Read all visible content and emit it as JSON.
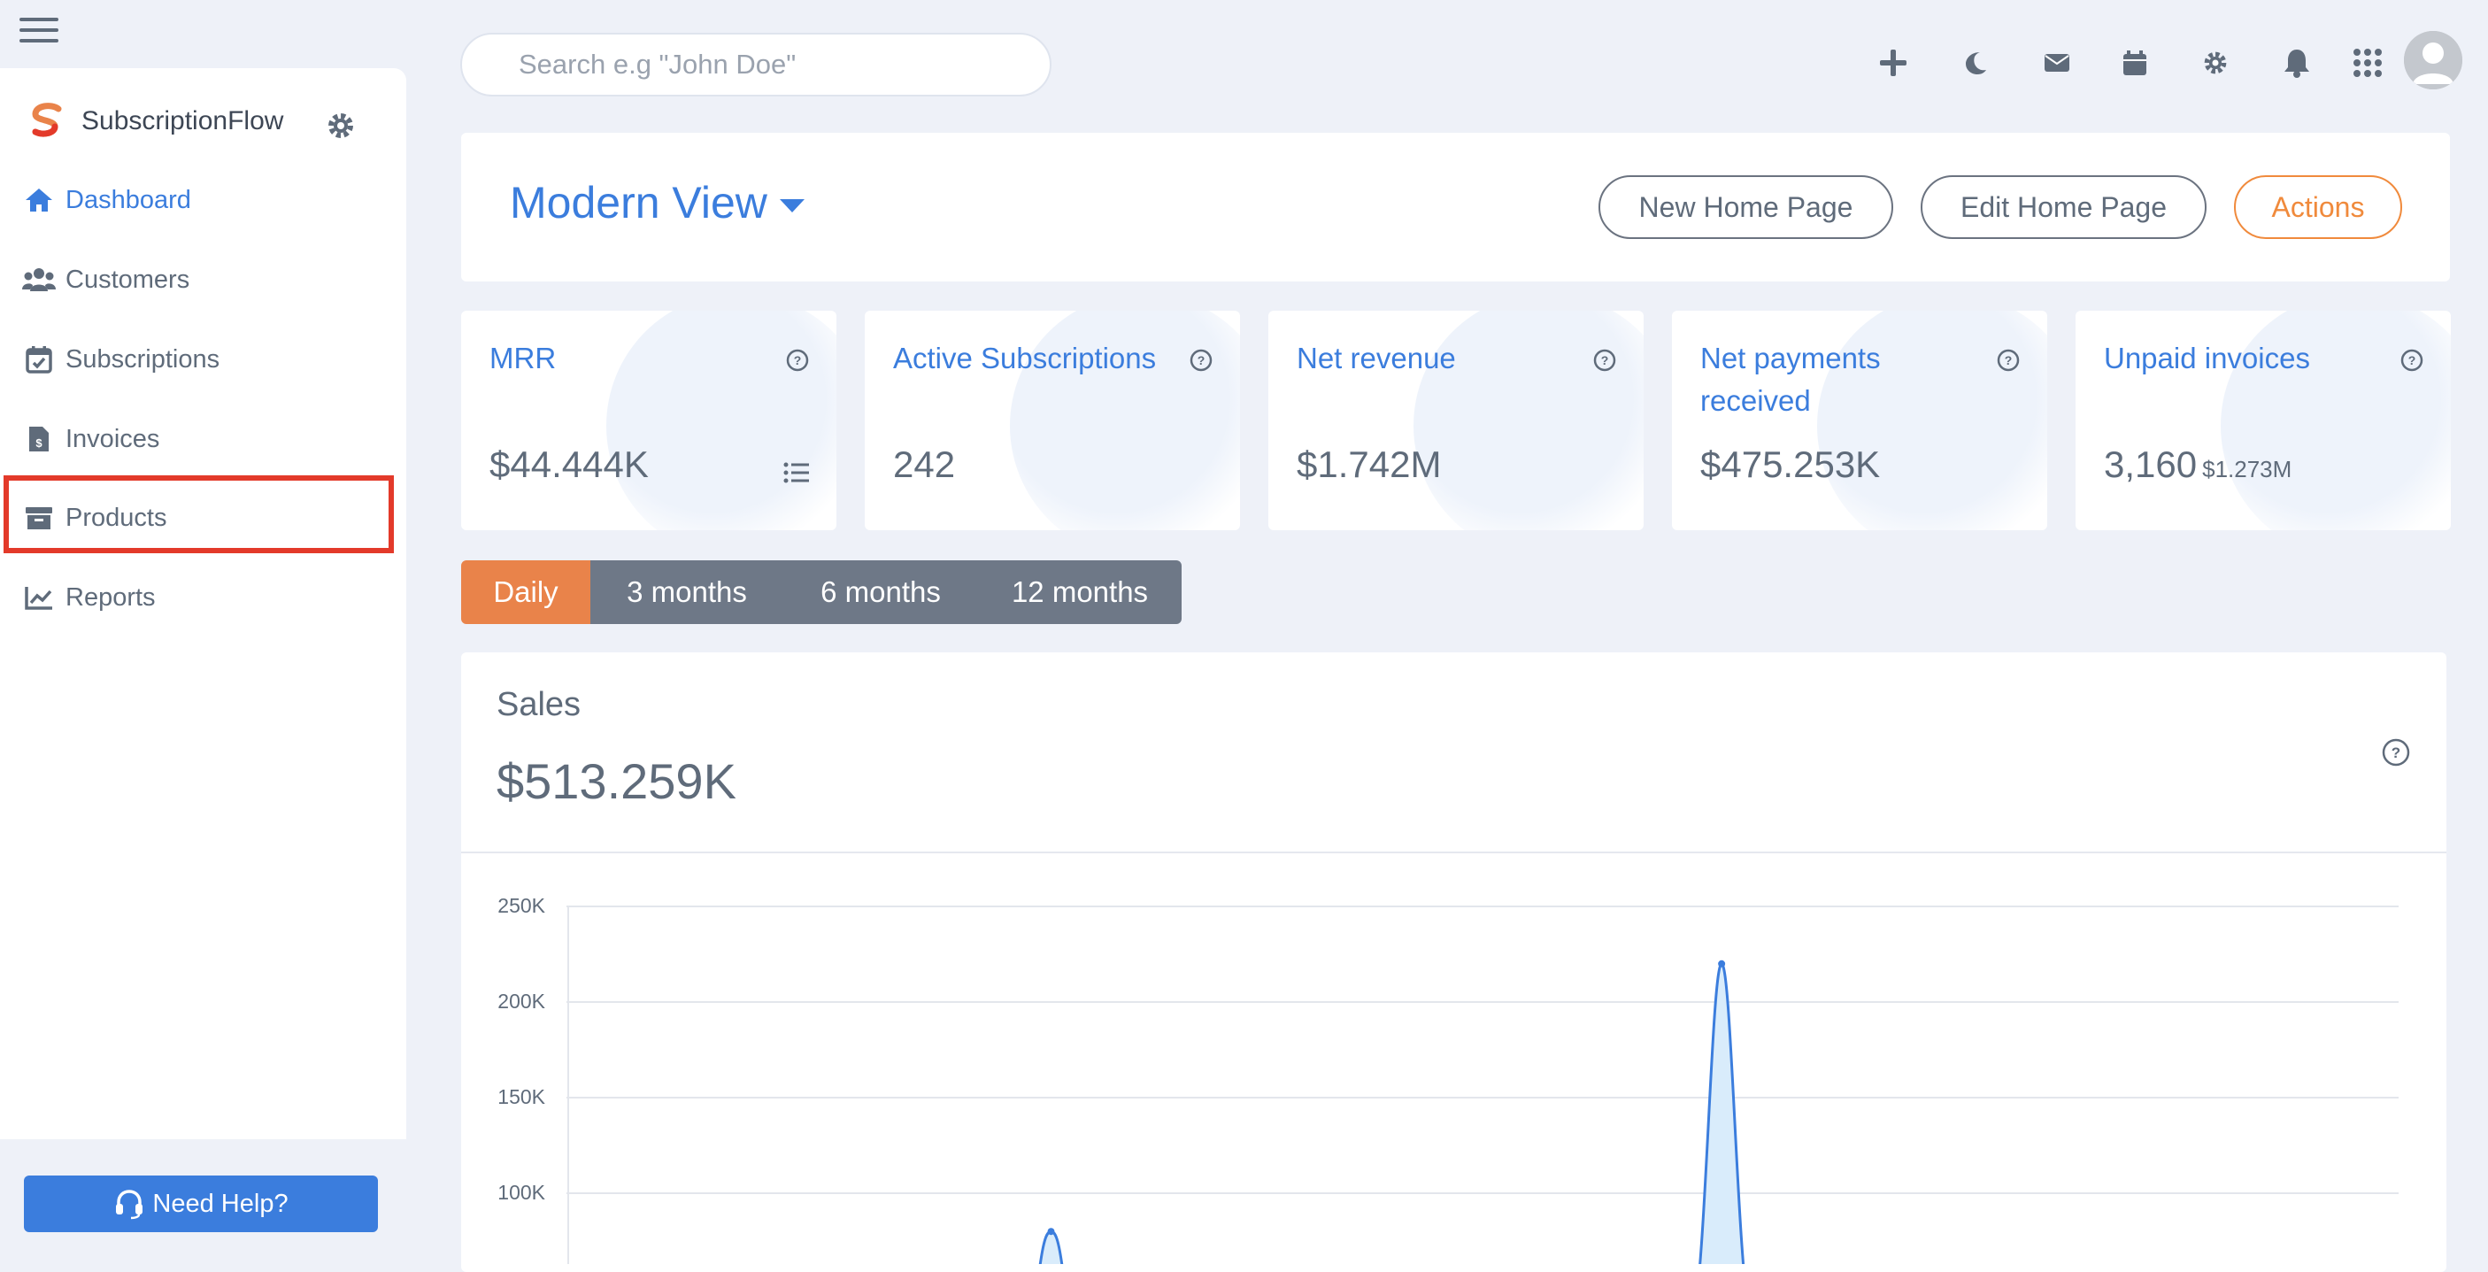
{
  "topbar": {
    "search_placeholder": "Search e.g \"John Doe\"",
    "icons": [
      "plus-icon",
      "moon-icon",
      "envelope-icon",
      "calendar-icon",
      "gear-icon",
      "bell-icon",
      "apps-grid-icon"
    ]
  },
  "sidebar": {
    "brand": "SubscriptionFlow",
    "items": [
      {
        "label": "Dashboard",
        "icon": "home-icon",
        "active": true
      },
      {
        "label": "Customers",
        "icon": "users-icon"
      },
      {
        "label": "Subscriptions",
        "icon": "calendar-check-icon"
      },
      {
        "label": "Invoices",
        "icon": "file-invoice-icon"
      },
      {
        "label": "Products",
        "icon": "archive-box-icon"
      },
      {
        "label": "Reports",
        "icon": "chart-line-icon"
      }
    ],
    "help_label": "Need Help?"
  },
  "header": {
    "view_title": "Modern View",
    "buttons": {
      "new": "New Home Page",
      "edit": "Edit Home Page",
      "actions": "Actions"
    }
  },
  "kpis": [
    {
      "title": "MRR",
      "value": "$44.444K"
    },
    {
      "title": "Active Subscriptions",
      "value": "242"
    },
    {
      "title": "Net revenue",
      "value": "$1.742M"
    },
    {
      "title": "Net payments received",
      "value": "$475.253K"
    },
    {
      "title": "Unpaid invoices",
      "value": "3,160",
      "sub": "$1.273M"
    }
  ],
  "periods": [
    "Daily",
    "3 months",
    "6 months",
    "12 months"
  ],
  "active_period": "Daily",
  "sales": {
    "label": "Sales",
    "value": "$513.259K"
  },
  "chart_data": {
    "type": "area",
    "ylabels": [
      "250K",
      "200K",
      "150K",
      "100K"
    ],
    "yticks": [
      250000,
      200000,
      150000,
      100000
    ],
    "ylim": [
      50000,
      250000
    ],
    "series": [
      {
        "points": [
          [
            0.0,
            0
          ],
          [
            0.27,
            80000
          ],
          [
            0.58,
            0
          ],
          [
            0.63,
            220000
          ],
          [
            0.7,
            0
          ],
          [
            1.0,
            0
          ]
        ]
      }
    ],
    "colors": {
      "line": "#3b7ddd",
      "fill": "#d9ecfb"
    }
  },
  "colors": {
    "accent": "#3b7ddd",
    "orange": "#e9834a",
    "highlight": "#e33a2a"
  }
}
